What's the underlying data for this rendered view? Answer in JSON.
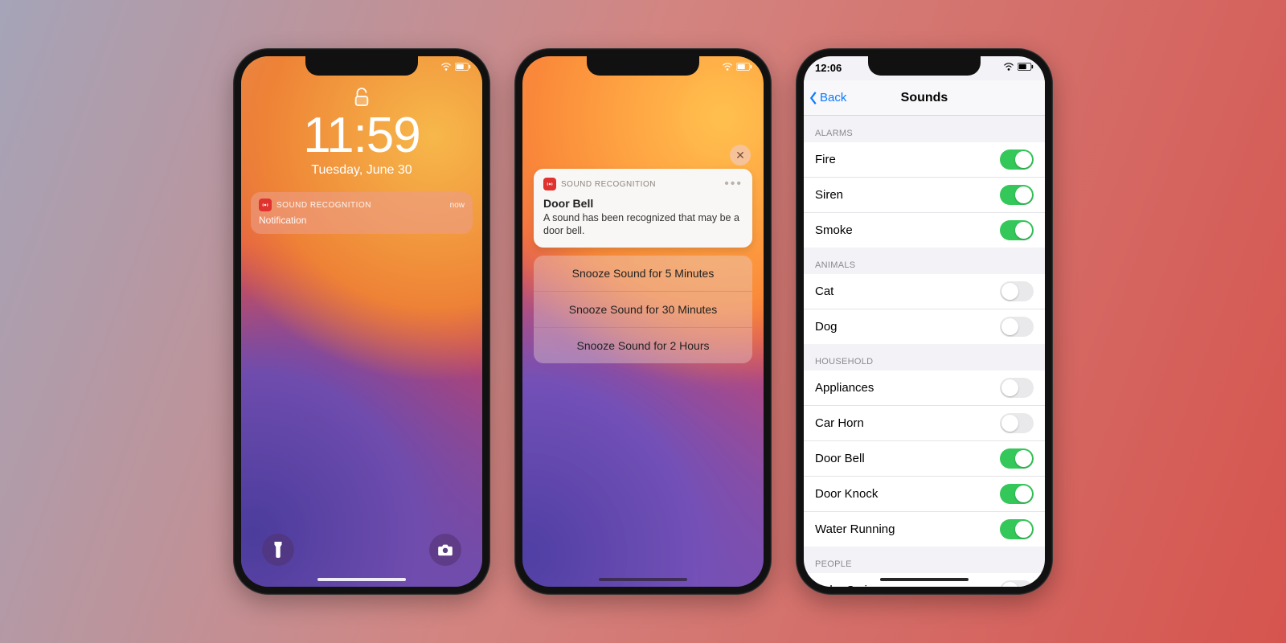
{
  "phone1": {
    "time": "11:59",
    "date": "Tuesday, June 30",
    "notification": {
      "app_name": "SOUND RECOGNITION",
      "timestamp": "now",
      "body": "Notification"
    }
  },
  "phone2": {
    "close_label": "✕",
    "notification": {
      "app_name": "SOUND RECOGNITION",
      "title": "Door Bell",
      "body": "A sound has been recognized that may be a door bell."
    },
    "actions": [
      "Snooze Sound for 5 Minutes",
      "Snooze Sound for 30 Minutes",
      "Snooze Sound for 2 Hours"
    ]
  },
  "phone3": {
    "status_time": "12:06",
    "back_label": "Back",
    "nav_title": "Sounds",
    "sections": [
      {
        "header": "ALARMS",
        "rows": [
          {
            "label": "Fire",
            "on": true
          },
          {
            "label": "Siren",
            "on": true
          },
          {
            "label": "Smoke",
            "on": true
          }
        ]
      },
      {
        "header": "ANIMALS",
        "rows": [
          {
            "label": "Cat",
            "on": false
          },
          {
            "label": "Dog",
            "on": false
          }
        ]
      },
      {
        "header": "HOUSEHOLD",
        "rows": [
          {
            "label": "Appliances",
            "on": false
          },
          {
            "label": "Car Horn",
            "on": false
          },
          {
            "label": "Door Bell",
            "on": true
          },
          {
            "label": "Door Knock",
            "on": true
          },
          {
            "label": "Water Running",
            "on": true
          }
        ]
      },
      {
        "header": "PEOPLE",
        "rows": [
          {
            "label": "Baby Crying",
            "on": false
          }
        ]
      }
    ]
  }
}
